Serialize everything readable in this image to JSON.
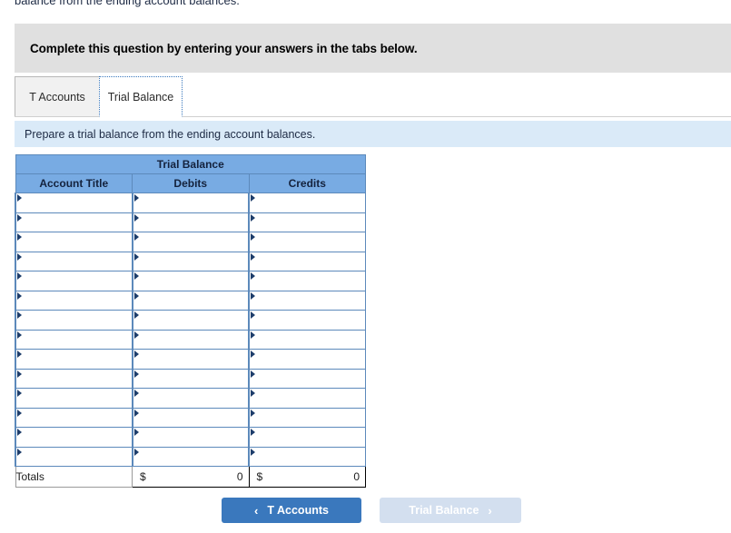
{
  "page": {
    "cutoff_text": "balance from the ending account balances."
  },
  "banner": {
    "text": "Complete this question by entering your answers in the tabs below."
  },
  "tabs": [
    {
      "label": "T Accounts",
      "active": false
    },
    {
      "label": "Trial Balance",
      "active": true
    }
  ],
  "prompt": {
    "text": "Prepare a trial balance from the ending account balances."
  },
  "worksheet": {
    "title": "Trial Balance",
    "columns": [
      "Account Title",
      "Debits",
      "Credits"
    ],
    "row_count": 14,
    "rows": [
      {
        "account": "",
        "debit": "",
        "credit": ""
      },
      {
        "account": "",
        "debit": "",
        "credit": ""
      },
      {
        "account": "",
        "debit": "",
        "credit": ""
      },
      {
        "account": "",
        "debit": "",
        "credit": ""
      },
      {
        "account": "",
        "debit": "",
        "credit": ""
      },
      {
        "account": "",
        "debit": "",
        "credit": ""
      },
      {
        "account": "",
        "debit": "",
        "credit": ""
      },
      {
        "account": "",
        "debit": "",
        "credit": ""
      },
      {
        "account": "",
        "debit": "",
        "credit": ""
      },
      {
        "account": "",
        "debit": "",
        "credit": ""
      },
      {
        "account": "",
        "debit": "",
        "credit": ""
      },
      {
        "account": "",
        "debit": "",
        "credit": ""
      },
      {
        "account": "",
        "debit": "",
        "credit": ""
      },
      {
        "account": "",
        "debit": "",
        "credit": ""
      }
    ],
    "totals": {
      "label": "Totals",
      "debit_symbol": "$",
      "debit_value": "0",
      "credit_symbol": "$",
      "credit_value": "0"
    }
  },
  "nav": {
    "prev": {
      "label": "T Accounts",
      "chevron": "‹",
      "enabled": true
    },
    "next": {
      "label": "Trial Balance",
      "chevron": "›",
      "enabled": false
    }
  },
  "colors": {
    "header_blue": "#78abe3",
    "cell_border_blue": "#5c89bb",
    "banner_grey": "#e0e0e0",
    "prompt_blue": "#daeaf8",
    "button_blue": "#3a78bd",
    "button_disabled": "#d3dfef"
  }
}
